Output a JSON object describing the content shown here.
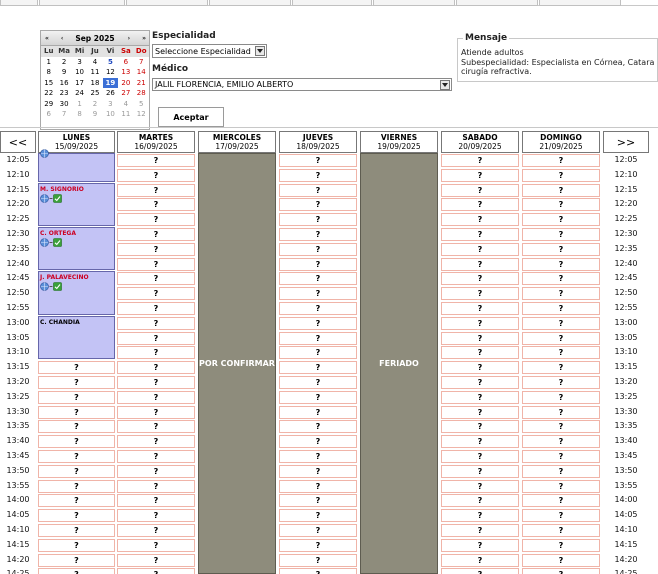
{
  "calendar": {
    "title": "Sep 2025",
    "prev_year": "«",
    "prev_month": "‹",
    "next_month": "›",
    "next_year": "»",
    "weekdays": [
      "Lu",
      "Ma",
      "Mi",
      "Ju",
      "Vi",
      "Sa",
      "Do"
    ],
    "weeks": [
      [
        "1",
        "2",
        "3",
        "4",
        "5",
        "6",
        "7"
      ],
      [
        "8",
        "9",
        "10",
        "11",
        "12",
        "13",
        "14"
      ],
      [
        "15",
        "16",
        "17",
        "18",
        "19",
        "20",
        "21"
      ],
      [
        "22",
        "23",
        "24",
        "25",
        "26",
        "27",
        "28"
      ],
      [
        "29",
        "30",
        "1",
        "2",
        "3",
        "4",
        "5"
      ],
      [
        "6",
        "7",
        "8",
        "9",
        "10",
        "11",
        "12"
      ]
    ],
    "selected_day": "19"
  },
  "form": {
    "especialidad_label": "Especialidad",
    "especialidad_value": "Seleccione Especialidad",
    "medico_label": "Médico",
    "medico_value": "JALIL FLORENCIA, EMILIO ALBERTO",
    "aceptar_label": "Aceptar"
  },
  "mensaje": {
    "title": "Mensaje",
    "line1": "Atiende adultos",
    "line2": "Subespecialidad: Especialista en Córnea, Catara",
    "line3": "cirugía refractiva."
  },
  "nav": {
    "prev": "<<",
    "next": ">>"
  },
  "days": [
    {
      "name": "LUNES",
      "date": "15/09/2025"
    },
    {
      "name": "MARTES",
      "date": "16/09/2025"
    },
    {
      "name": "MIERCOLES",
      "date": "17/09/2025"
    },
    {
      "name": "JUEVES",
      "date": "18/09/2025"
    },
    {
      "name": "VIERNES",
      "date": "19/09/2025"
    },
    {
      "name": "SABADO",
      "date": "20/09/2025"
    },
    {
      "name": "DOMINGO",
      "date": "21/09/2025"
    }
  ],
  "times": [
    "12:05",
    "12:10",
    "12:15",
    "12:20",
    "12:25",
    "12:30",
    "12:35",
    "12:40",
    "12:45",
    "12:50",
    "12:55",
    "13:00",
    "13:05",
    "13:10",
    "13:15",
    "13:20",
    "13:25",
    "13:30",
    "13:35",
    "13:40",
    "13:45",
    "13:50",
    "13:55",
    "14:00",
    "14:05",
    "14:10",
    "14:15",
    "14:20",
    "14:25"
  ],
  "slot_mark": "?",
  "bookings": [
    {
      "name": "",
      "start": 0,
      "span": 2,
      "color": "red"
    },
    {
      "name": "M. SIGNORIO",
      "start": 2,
      "span": 3,
      "color": "red"
    },
    {
      "name": "C. ORTEGA",
      "start": 5,
      "span": 3,
      "color": "red"
    },
    {
      "name": "J. PALAVECINO",
      "start": 8,
      "span": 3,
      "color": "red"
    },
    {
      "name": "C. CHANDIA",
      "start": 11,
      "span": 3,
      "color": "black"
    }
  ],
  "blocks": {
    "miercoles": "POR CONFIRMAR",
    "viernes": "FERIADO"
  },
  "colors": {
    "booked_bg": "#c3c3f5",
    "block_bg": "#8e8c7c",
    "slot_border": "#f0b4a8",
    "selected_day": "#3b6fd6"
  }
}
